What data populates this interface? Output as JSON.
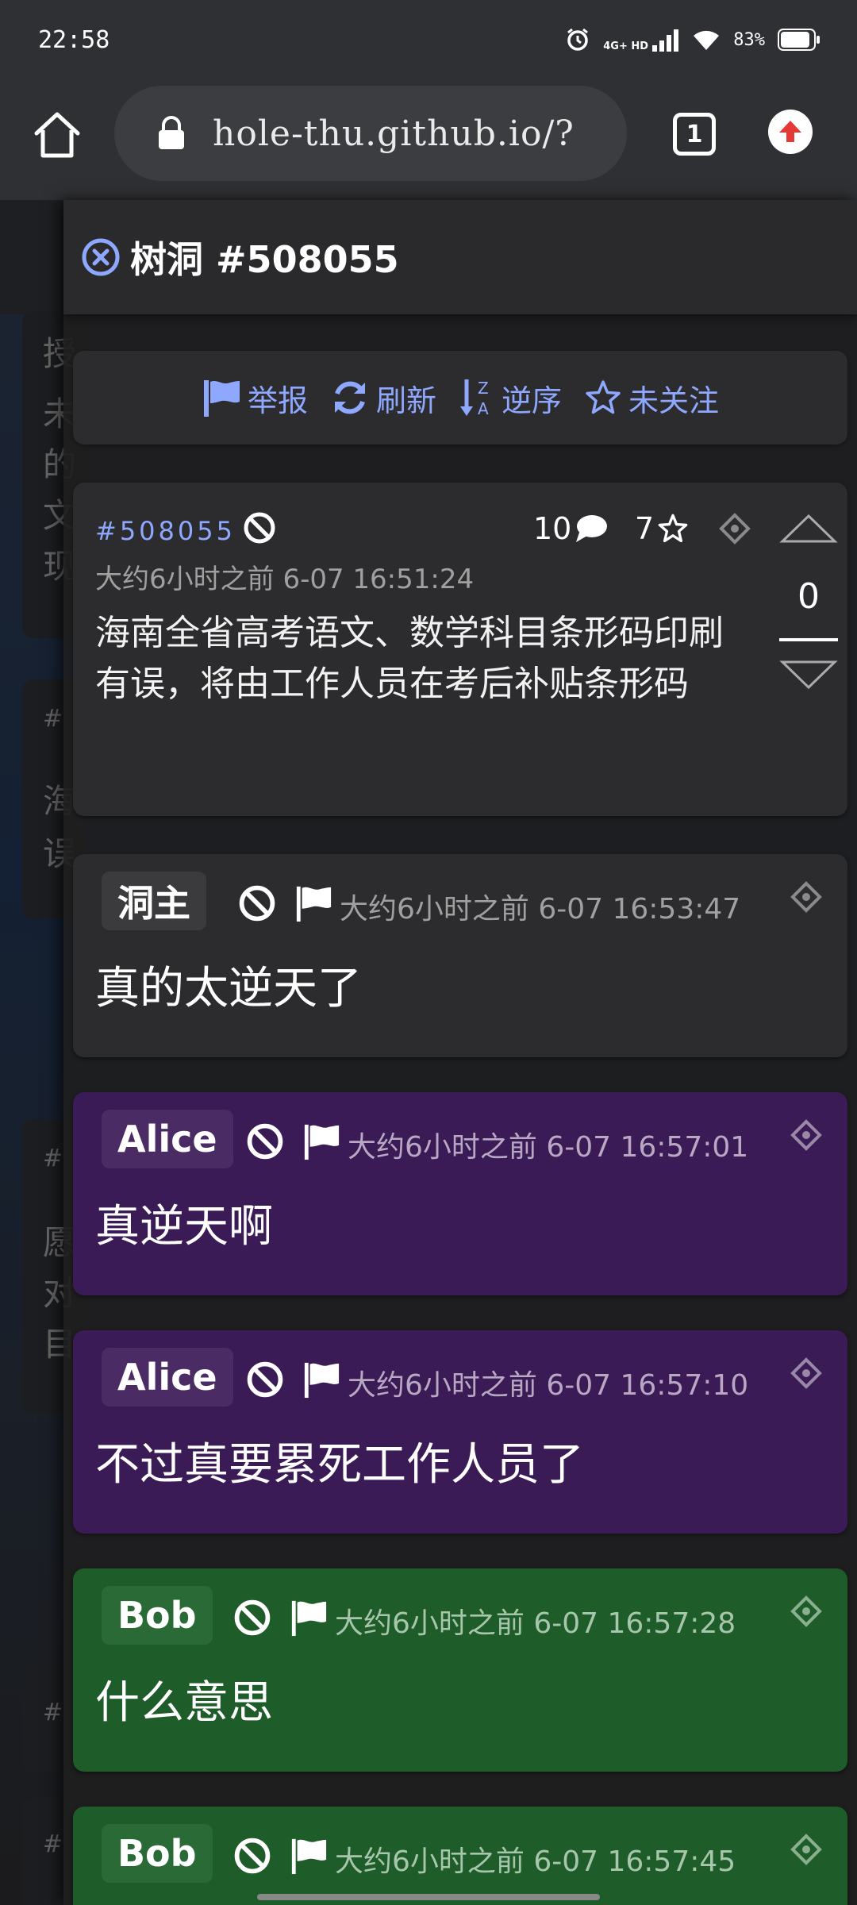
{
  "status_bar": {
    "time": "22:58",
    "network": "4G+ HD",
    "battery_percent": "83%"
  },
  "browser": {
    "url": "hole-thu.github.io/?",
    "tab_count": "1"
  },
  "background_page": {
    "glyphs": [
      "授",
      "未",
      "的",
      "文",
      "现",
      "#",
      "海",
      "误",
      "#",
      "愿",
      "对",
      "目",
      "#",
      "#"
    ]
  },
  "sidebar": {
    "title": "树洞 #508055",
    "toolbar": {
      "report": "举报",
      "refresh": "刷新",
      "reverse": "逆序",
      "follow": "未关注"
    },
    "post": {
      "id": "#508055",
      "reply_count": "10",
      "star_count": "7",
      "time": "大约6小时之前 6-07 16:51:24",
      "text": "海南全省高考语文、数学科目条形码印刷有误，将由工作人员在考后补贴条形码",
      "votes": "0"
    },
    "replies": [
      {
        "name": "洞主",
        "time": "大约6小时之前 6-07 16:53:47",
        "text": "真的太逆天了",
        "color": "#2c2c2e"
      },
      {
        "name": "Alice",
        "time": "大约6小时之前 6-07 16:57:01",
        "text": "真逆天啊",
        "color": "#3b1b55"
      },
      {
        "name": "Alice",
        "time": "大约6小时之前 6-07 16:57:10",
        "text": "不过真要累死工作人员了",
        "color": "#3b1b55"
      },
      {
        "name": "Bob",
        "time": "大约6小时之前 6-07 16:57:28",
        "text": "什么意思",
        "color": "#1e5c2a"
      },
      {
        "name": "Bob",
        "time": "大约6小时之前 6-07 16:57:45",
        "text": "",
        "color": "#1e5c2a"
      }
    ]
  },
  "colors": {
    "accent": "#8fa8ff",
    "update_red": "#e53935"
  }
}
